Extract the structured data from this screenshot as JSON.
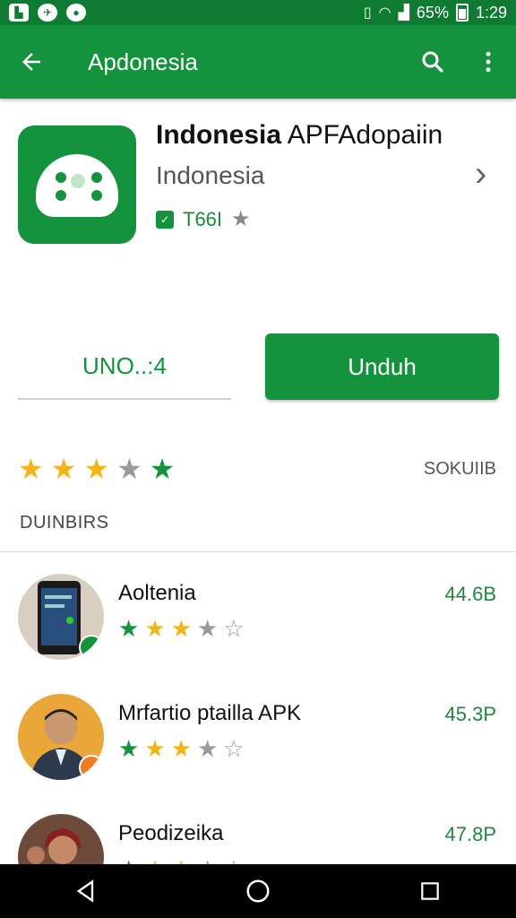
{
  "status_bar": {
    "battery": "65%",
    "time": "1:29"
  },
  "app_bar": {
    "title": "Apdonesia",
    "back_icon": "arrow-back-icon",
    "search_icon": "search-icon",
    "menu_icon": "more-vert-icon"
  },
  "app": {
    "name_bold": "Indonesia",
    "name_rest": " APFAdopaiin",
    "developer": "Indonesia",
    "size": "T66I",
    "icon": "gamepad-icon"
  },
  "buttons": {
    "secondary_label": "UNO..:4",
    "install_label": "Unduh"
  },
  "rating": {
    "stars": [
      "gold",
      "gold",
      "gold",
      "grey",
      "green"
    ],
    "label": "SOKUIIB"
  },
  "section": {
    "title": "DUINBIRS"
  },
  "list": [
    {
      "name": "Aoltenia",
      "size": "44.6B",
      "stars": [
        "green",
        "gold",
        "gold",
        "grey",
        "outline"
      ]
    },
    {
      "name": "Mrfartio ptailla APK",
      "size": "45.3P",
      "stars": [
        "green",
        "gold",
        "gold",
        "grey",
        "outline"
      ]
    },
    {
      "name": "Peodizeika",
      "size": "47.8P",
      "stars": [
        "green",
        "gold",
        "gold",
        "grey",
        "outline"
      ]
    }
  ],
  "colors": {
    "status_bar": "#0e7a32",
    "app_bar": "#15923d",
    "accent": "#15923d",
    "star_gold": "#f2b418"
  }
}
